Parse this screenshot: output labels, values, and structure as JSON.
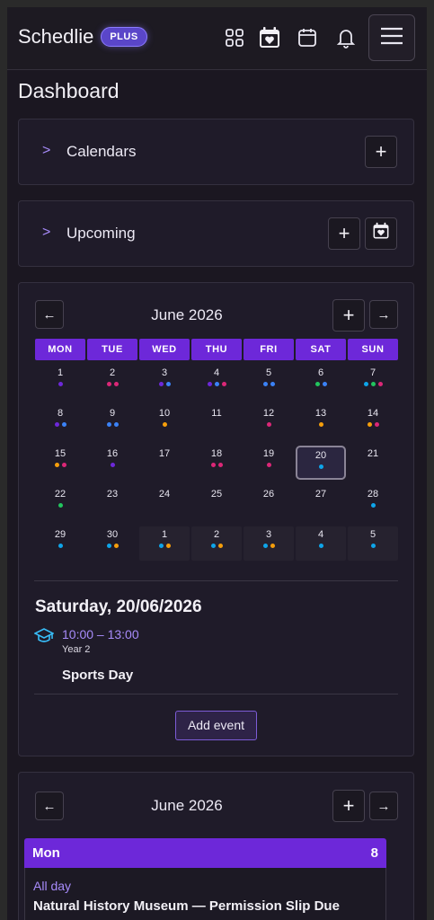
{
  "header": {
    "app_name": "Schedlie",
    "badge": "PLUS",
    "icons": [
      "grid-icon",
      "calendar-heart-icon",
      "calendar-icon",
      "bell-icon",
      "menu-icon"
    ]
  },
  "page_title": "Dashboard",
  "calendars_section": {
    "label": "Calendars",
    "add_button": "+"
  },
  "upcoming_section": {
    "label": "Upcoming",
    "add_button": "+"
  },
  "month_view": {
    "title": "June 2026",
    "prev": "←",
    "next": "→",
    "add": "+",
    "weekdays": [
      "MON",
      "TUE",
      "WED",
      "THU",
      "FRI",
      "SAT",
      "SUN"
    ],
    "selected_day": "20",
    "days": [
      {
        "d": "1",
        "dots": [
          "#6d28d9"
        ]
      },
      {
        "d": "2",
        "dots": [
          "#db2777",
          "#db2777"
        ]
      },
      {
        "d": "3",
        "dots": [
          "#6d28d9",
          "#3b82f6"
        ]
      },
      {
        "d": "4",
        "dots": [
          "#6d28d9",
          "#3b82f6",
          "#db2777"
        ]
      },
      {
        "d": "5",
        "dots": [
          "#3b82f6",
          "#3b82f6"
        ]
      },
      {
        "d": "6",
        "dots": [
          "#22c55e",
          "#3b82f6"
        ]
      },
      {
        "d": "7",
        "dots": [
          "#0ea5e9",
          "#22c55e",
          "#db2777"
        ]
      },
      {
        "d": "8",
        "dots": [
          "#6d28d9",
          "#3b82f6"
        ]
      },
      {
        "d": "9",
        "dots": [
          "#3b82f6",
          "#3b82f6"
        ]
      },
      {
        "d": "10",
        "dots": [
          "#f59e0b"
        ]
      },
      {
        "d": "11",
        "dots": []
      },
      {
        "d": "12",
        "dots": [
          "#db2777"
        ]
      },
      {
        "d": "13",
        "dots": [
          "#f59e0b"
        ]
      },
      {
        "d": "14",
        "dots": [
          "#f59e0b",
          "#db2777"
        ]
      },
      {
        "d": "15",
        "dots": [
          "#f59e0b",
          "#db2777"
        ]
      },
      {
        "d": "16",
        "dots": [
          "#6d28d9"
        ]
      },
      {
        "d": "17",
        "dots": []
      },
      {
        "d": "18",
        "dots": [
          "#db2777",
          "#db2777"
        ]
      },
      {
        "d": "19",
        "dots": [
          "#db2777"
        ]
      },
      {
        "d": "20",
        "dots": [
          "#0ea5e9"
        ]
      },
      {
        "d": "21",
        "dots": []
      },
      {
        "d": "22",
        "dots": [
          "#22c55e"
        ]
      },
      {
        "d": "23",
        "dots": []
      },
      {
        "d": "24",
        "dots": []
      },
      {
        "d": "25",
        "dots": []
      },
      {
        "d": "26",
        "dots": []
      },
      {
        "d": "27",
        "dots": []
      },
      {
        "d": "28",
        "dots": [
          "#0ea5e9"
        ]
      },
      {
        "d": "29",
        "dots": [
          "#0ea5e9"
        ]
      },
      {
        "d": "30",
        "dots": [
          "#0ea5e9",
          "#f59e0b"
        ]
      },
      {
        "d": "1",
        "dots": [
          "#0ea5e9",
          "#f59e0b"
        ],
        "next": true
      },
      {
        "d": "2",
        "dots": [
          "#0ea5e9",
          "#f59e0b"
        ],
        "next": true
      },
      {
        "d": "3",
        "dots": [
          "#0ea5e9",
          "#f59e0b"
        ],
        "next": true
      },
      {
        "d": "4",
        "dots": [
          "#0ea5e9"
        ],
        "next": true
      },
      {
        "d": "5",
        "dots": [
          "#0ea5e9"
        ],
        "next": true
      }
    ]
  },
  "selected_day_detail": {
    "date": "Saturday, 20/06/2026",
    "event": {
      "time": "10:00 – 13:00",
      "calendar": "Year 2",
      "title": "Sports Day",
      "icon": "graduation-cap-icon"
    },
    "add_event": "Add event"
  },
  "agenda_view": {
    "title": "June 2026",
    "prev": "←",
    "next": "→",
    "add": "+",
    "day_name": "Mon",
    "day_num": "8",
    "allday": "All day",
    "event_title": "Natural History Museum — Permission Slip Due"
  },
  "colors": {
    "accent": "#6d28d9",
    "accent_light": "#a78bfa",
    "background": "#1b1721",
    "card": "#1f1b29"
  }
}
